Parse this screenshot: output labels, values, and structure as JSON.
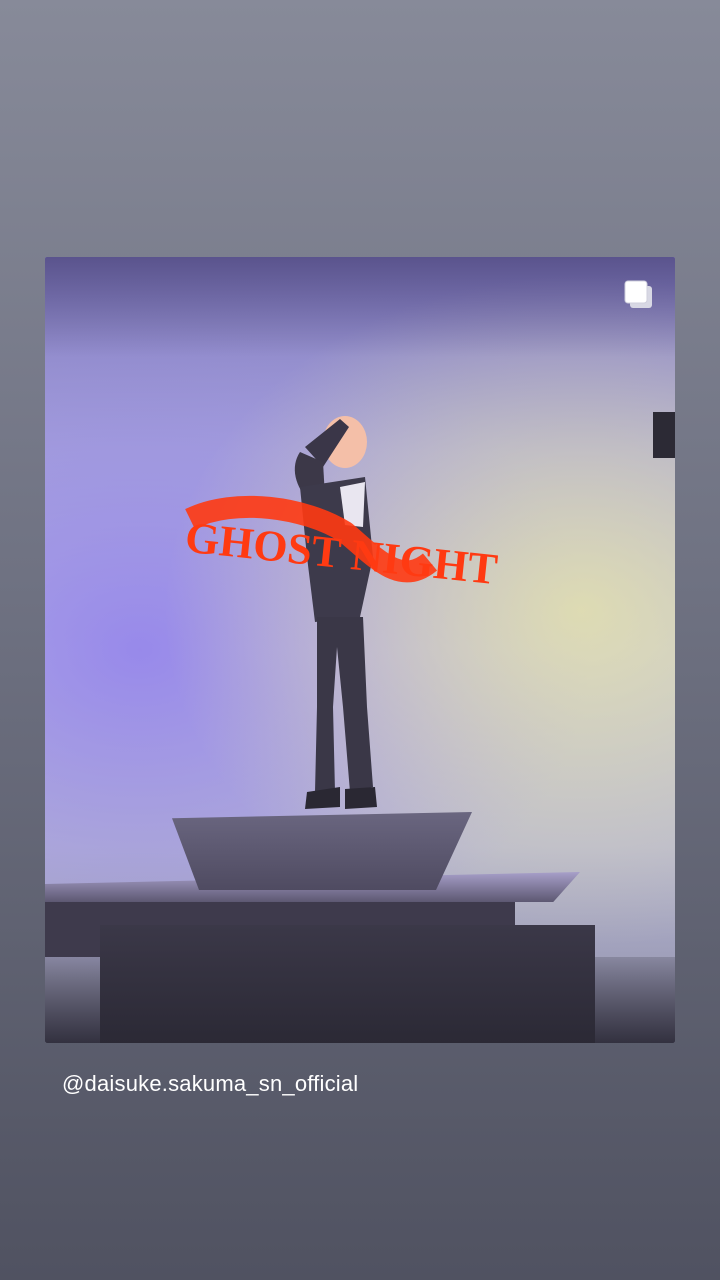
{
  "post": {
    "sticker_text": "GHOST NIGHT",
    "carousel_icon": "multiple-photos-icon",
    "colors": {
      "sticker": "#ff3a12",
      "text": "#ffffff"
    }
  },
  "mention": {
    "handle": "@daisuke.sakuma_sn_official"
  }
}
